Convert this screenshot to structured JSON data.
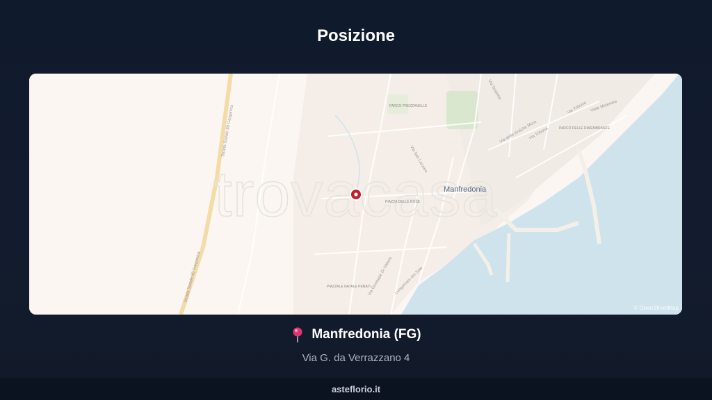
{
  "header": {
    "title": "Posizione"
  },
  "map": {
    "watermark": "trovacasa",
    "city_label": "Manfredonia",
    "attribution": "© OpenStreetMap",
    "labels": {
      "statale_1": "Strada Statale 89 Garganica",
      "statale_2": "Strada Statale 89 Garganica",
      "parco_1": "PARCO PREZZANELLE",
      "parco_2": "PARCO DELLE RIMEMBRANZE",
      "piazza_1": "PIAZZA DELLE ROSE",
      "piazza_2": "PIAZZALE NATALE PENATI",
      "via_scaloria": "Via Scaloria",
      "via_antiche_mura": "Via delle Antiche Mura",
      "via_tribuna_1": "Via Tribuna",
      "via_tribuna_2": "Via Tribuna",
      "via_di_vittorio": "Via Giuseppe Di Vittorio",
      "lungomare": "Lungomare del Sole",
      "viale_miramare": "Viale Miramare",
      "via_san_lazzaro": "Via San Lazzaro"
    },
    "colors": {
      "land": "#fbf6f1",
      "sea": "#cfe3ec",
      "marker": "#c0202c",
      "park": "#d9e7cf"
    }
  },
  "location": {
    "pin_icon": "map-pin-icon",
    "city": "Manfredonia (FG)",
    "address": "Via G. da Verrazzano 4"
  },
  "footer": {
    "site": "asteflorio.it"
  }
}
